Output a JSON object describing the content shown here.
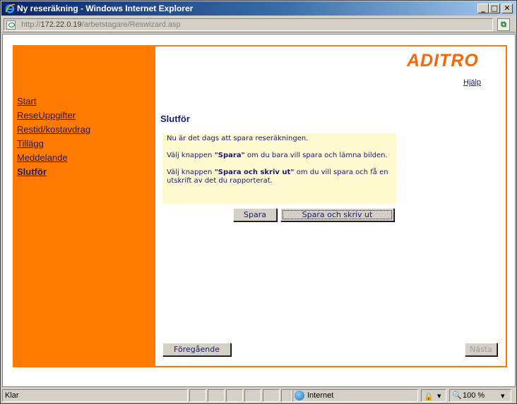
{
  "window": {
    "title": "Ny reseräkning - Windows Internet Explorer",
    "minimize": "_",
    "maximize": "□",
    "close": "✕"
  },
  "address": {
    "url_prefix": "http://",
    "url_host": "172.22.0.19",
    "url_path": "/arbetstagare/Reswizard.asp"
  },
  "nav": {
    "items": [
      {
        "label": "Start",
        "active": false
      },
      {
        "label": "ReseUppgifter",
        "active": false
      },
      {
        "label": "Restid/kostavdrag",
        "active": false
      },
      {
        "label": "Tillägg",
        "active": false
      },
      {
        "label": "Meddelande",
        "active": false
      },
      {
        "label": "Slutför",
        "active": true
      }
    ]
  },
  "header": {
    "logo": "ADITRO",
    "help": "Hjälp",
    "brand_color": "#ff7a00"
  },
  "main": {
    "title": "Slutför",
    "info": {
      "line1": "Nu är det dags att spara reseräkningen.",
      "line2_pre": "Välj knappen ",
      "line2_bold": "\"Spara\"",
      "line2_post": " om du bara vill spara och lämna bilden.",
      "line3_pre": "Välj knappen ",
      "line3_bold": "\"Spara och skriv ut\"",
      "line3_post": " om du vill spara och få en utskrift av det du rapporterat."
    },
    "buttons": {
      "save": "Spara",
      "save_print": "Spara och skriv ut",
      "previous": "Föregående",
      "next": "Nästa"
    }
  },
  "status": {
    "text": "Klar",
    "zone": "Internet",
    "lock": "🔒",
    "zoom": "100 %",
    "dropdown": "▾"
  },
  "icons": {
    "browser": "ie-icon",
    "page": "page-icon",
    "compat": "compat-view-icon",
    "zone": "globe-icon"
  }
}
